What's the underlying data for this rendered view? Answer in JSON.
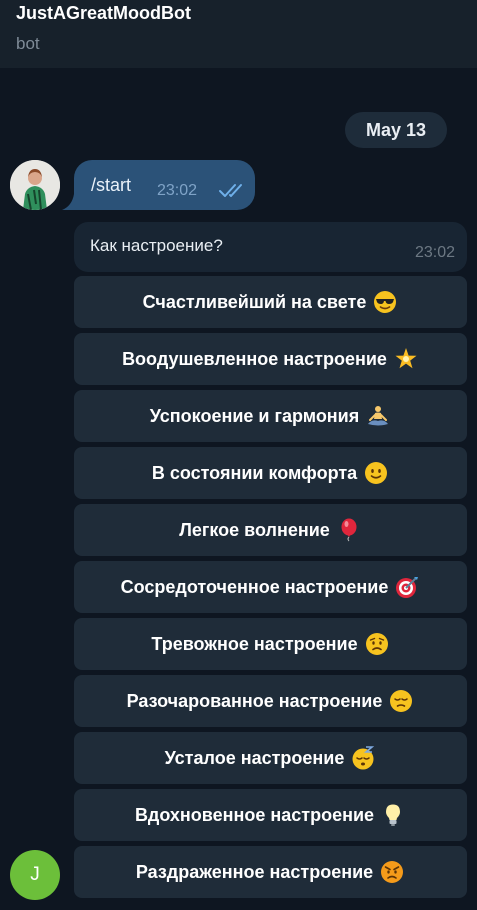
{
  "header": {
    "title": "JustAGreatMoodBot",
    "subtitle": "bot"
  },
  "date_pill": "May 13",
  "outgoing": {
    "text": "/start",
    "time": "23:02",
    "status_icon": "double-check-icon"
  },
  "incoming": {
    "text": "Как настроение?",
    "time": "23:02"
  },
  "keyboard": [
    {
      "label": "Счастливейший на свете",
      "icon": "sunglasses-face-icon"
    },
    {
      "label": "Воодушевленное настроение",
      "icon": "glowing-star-icon"
    },
    {
      "label": "Успокоение и гармония",
      "icon": "meditating-person-icon"
    },
    {
      "label": "В состоянии комфорта",
      "icon": "slight-smile-icon"
    },
    {
      "label": "Легкое волнение",
      "icon": "balloon-icon"
    },
    {
      "label": "Сосредоточенное настроение",
      "icon": "target-dart-icon"
    },
    {
      "label": "Тревожное настроение",
      "icon": "worried-face-icon"
    },
    {
      "label": "Разочарованное настроение",
      "icon": "disappointed-face-icon"
    },
    {
      "label": "Усталое настроение",
      "icon": "sleeping-face-icon"
    },
    {
      "label": "Вдохновенное настроение",
      "icon": "light-bulb-icon"
    },
    {
      "label": "Раздраженное настроение",
      "icon": "angry-face-icon"
    }
  ],
  "bot_avatar_letter": "J",
  "colors": {
    "background": "#0e1621",
    "header": "#17212b",
    "outgoing_bubble": "#2b5278",
    "incoming_bubble": "#182533",
    "keyboard_button": "#1f2c39",
    "bot_avatar": "#6cbf3a"
  }
}
